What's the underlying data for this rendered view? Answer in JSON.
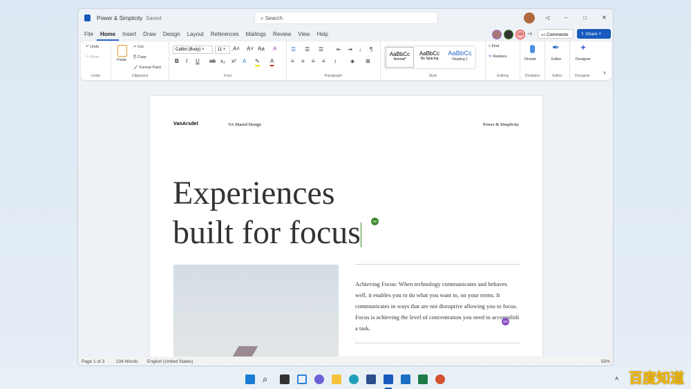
{
  "window": {
    "doc_title": "Power & Simplicity",
    "save_status": "Saved",
    "search_placeholder": "Search"
  },
  "tabs": [
    "File",
    "Home",
    "Insert",
    "Draw",
    "Design",
    "Layout",
    "References",
    "Mailings",
    "Review",
    "View",
    "Help"
  ],
  "active_tab": "Home",
  "collab": {
    "initials": "MM",
    "extra_count": "+6",
    "comments_label": "Comments",
    "share_label": "Share"
  },
  "ribbon": {
    "undo": {
      "undo": "Undo",
      "redo": "Redo",
      "label": "Undo"
    },
    "clipboard": {
      "paste": "Paste",
      "cut": "Cut",
      "copy": "Copy",
      "format_paint": "Format Paint",
      "label": "Clipboard"
    },
    "font": {
      "name": "Calibri (Body)",
      "size": "11",
      "label": "Font"
    },
    "paragraph": {
      "label": "Paragraph"
    },
    "style": {
      "items": [
        {
          "sample": "AaBbCc",
          "name": "Normal*"
        },
        {
          "sample": "AaBbCc",
          "name": "No Spacing"
        },
        {
          "sample": "AaBbCc",
          "name": "Heading 1"
        }
      ],
      "label": "Style"
    },
    "editing": {
      "find": "Find",
      "replace": "Replace",
      "label": "Editing"
    },
    "dictation": {
      "button": "Dictate",
      "label": "Dictation"
    },
    "editor": {
      "button": "Editor",
      "label": "Editor"
    },
    "designer": {
      "button": "Designer",
      "label": "Designer"
    }
  },
  "document": {
    "header_logo": "VanArsdel",
    "header_center": "VA Shared Design",
    "header_right": "Power & Simplicity",
    "headline_1": "Experiences",
    "headline_2": "built for focus",
    "cursor_mk": "MK",
    "cursor_en": "EN",
    "body": "Achieving Focus: When technology communicates and behaves well, it enables you to do what you want to, on your terms. It communicates in ways that are not disruptive allowing you to focus. Focus is achieving the level of concentration you need to accomplish a task."
  },
  "status": {
    "page": "Page 1 of 3",
    "words": "234 Words",
    "language": "English (United States)",
    "zoom": "50%"
  },
  "taskbar": {
    "apps": [
      "start",
      "search",
      "task-view",
      "widgets",
      "teams",
      "file-explorer",
      "edge",
      "store",
      "word",
      "outlook",
      "excel",
      "powerpoint"
    ]
  },
  "watermark": "百度知道",
  "colors": {
    "accent": "#2b64c7",
    "word": "#185abd",
    "mk": "#3a8a2a",
    "en": "#8a4fc4"
  }
}
